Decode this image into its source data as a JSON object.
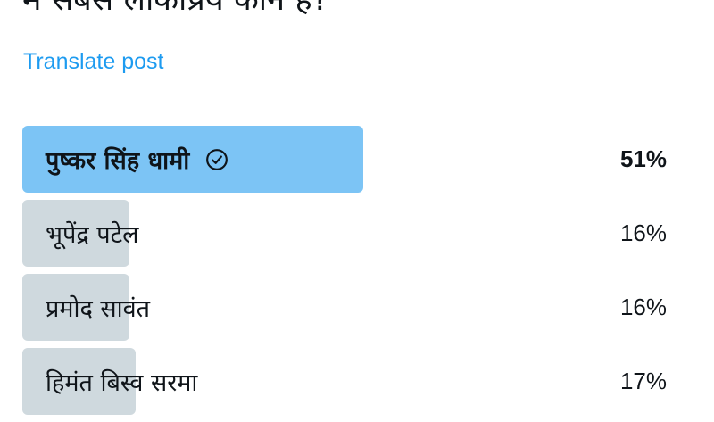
{
  "post": {
    "question": "में सबसे लोकप्रिय कौन है?",
    "translate_label": "Translate post"
  },
  "poll": {
    "options": [
      {
        "label": "पुष्कर सिंह धामी",
        "percent_text": "51%",
        "percent": 51,
        "winner": true
      },
      {
        "label": "भूपेंद्र पटेल",
        "percent_text": "16%",
        "percent": 16,
        "winner": false
      },
      {
        "label": "प्रमोद सावंत",
        "percent_text": "16%",
        "percent": 16,
        "winner": false
      },
      {
        "label": "हिमंत बिस्व सरमा",
        "percent_text": "17%",
        "percent": 17,
        "winner": false
      }
    ]
  },
  "colors": {
    "winner_bar": "#7cc4f5",
    "other_bar": "#cfd9de",
    "link": "#1d9bf0",
    "text": "#0f1419"
  },
  "icons": {
    "winner_marker": "check-circle-icon"
  }
}
